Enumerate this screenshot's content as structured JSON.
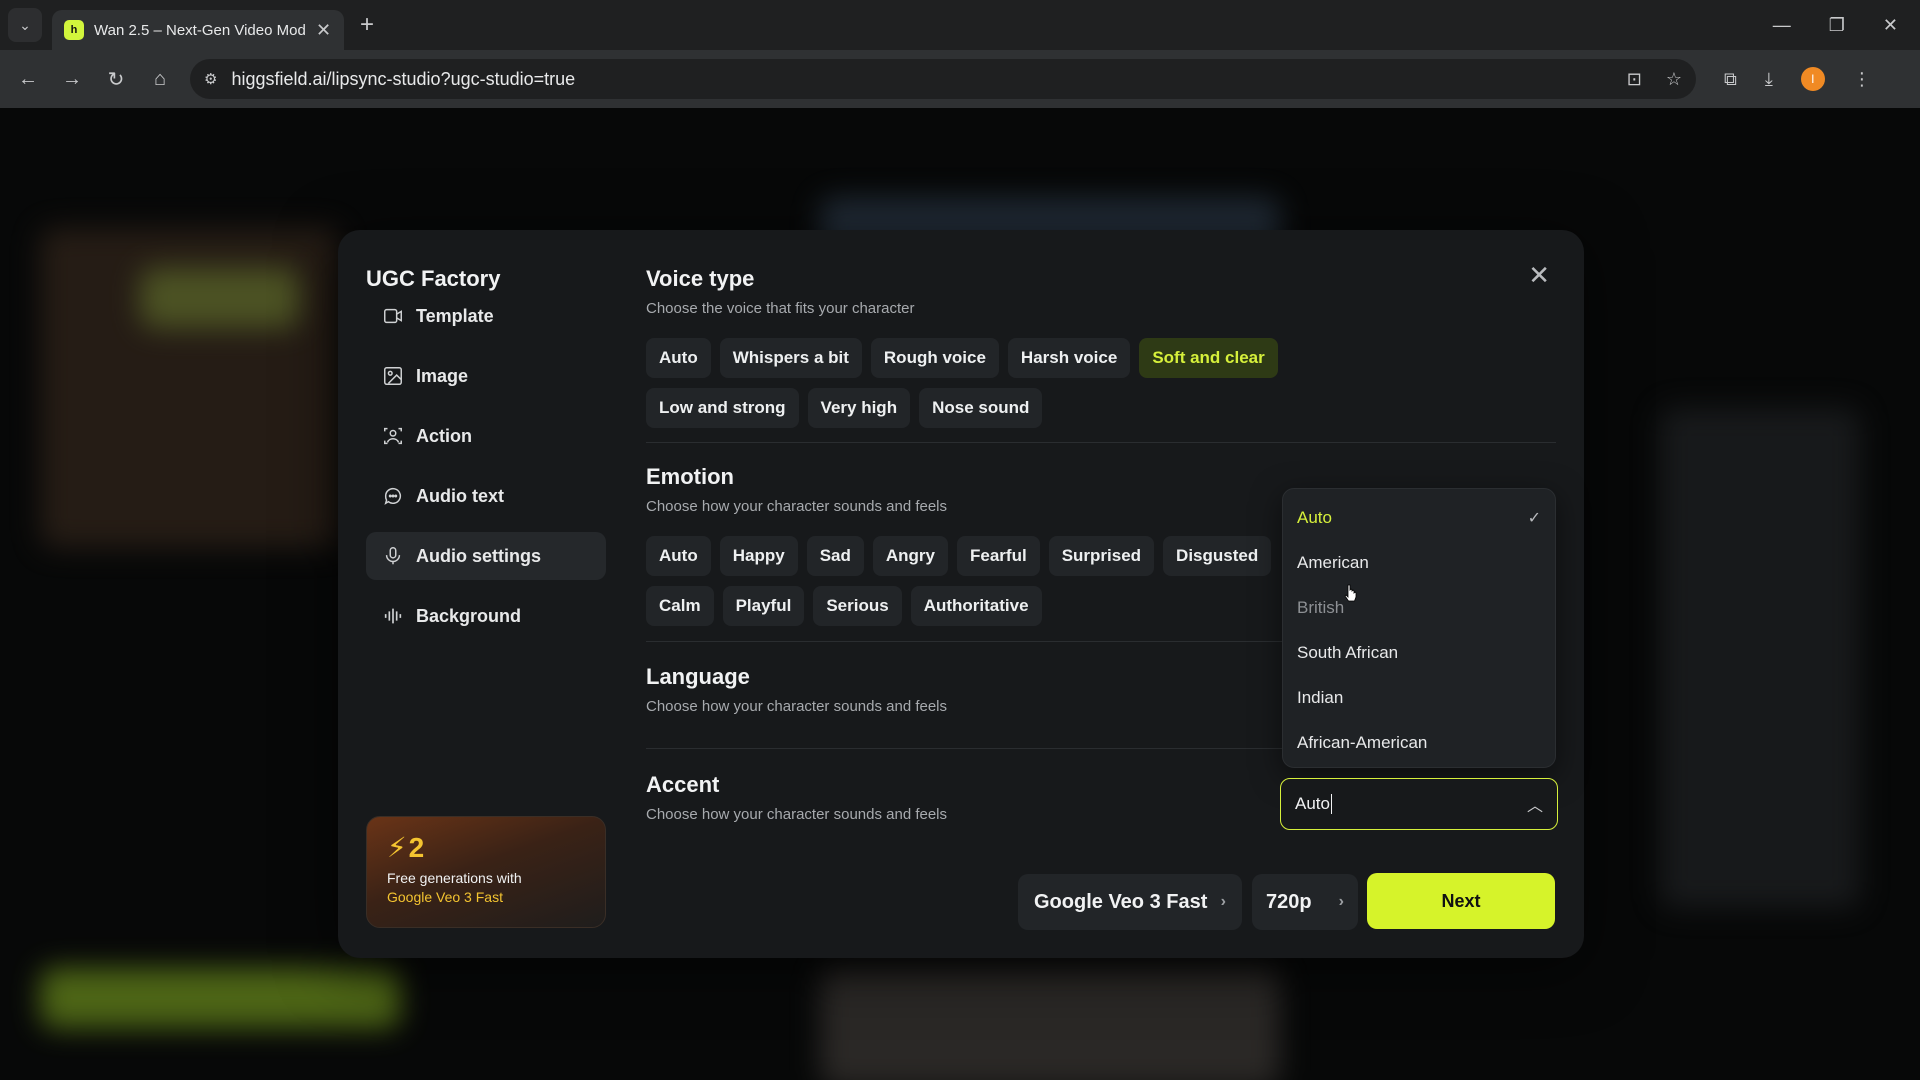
{
  "browser": {
    "tab_title": "Wan 2.5 – Next-Gen Video Mod",
    "url": "higgsfield.ai/lipsync-studio?ugc-studio=true"
  },
  "modal": {
    "title": "UGC Factory",
    "sidebar": [
      {
        "label": "Template",
        "icon": "template-icon"
      },
      {
        "label": "Image",
        "icon": "image-icon"
      },
      {
        "label": "Action",
        "icon": "action-icon"
      },
      {
        "label": "Audio text",
        "icon": "audio-text-icon"
      },
      {
        "label": "Audio settings",
        "icon": "microphone-icon",
        "active": true
      },
      {
        "label": "Background",
        "icon": "waveform-icon"
      }
    ],
    "promo": {
      "count": "2",
      "text": "Free generations with",
      "model": "Google Veo 3 Fast"
    },
    "voice_type": {
      "title": "Voice type",
      "subtitle": "Choose the voice that fits your character",
      "row1": [
        "Auto",
        "Whispers a bit",
        "Rough voice",
        "Harsh voice",
        "Soft and clear"
      ],
      "row2": [
        "Low and strong",
        "Very high",
        "Nose sound"
      ],
      "selected": "Soft and clear"
    },
    "emotion": {
      "title": "Emotion",
      "subtitle": "Choose how your character sounds and feels",
      "row1": [
        "Auto",
        "Happy",
        "Sad",
        "Angry",
        "Fearful",
        "Surprised",
        "Disgusted"
      ],
      "row2": [
        "Calm",
        "Playful",
        "Serious",
        "Authoritative"
      ]
    },
    "language": {
      "title": "Language",
      "subtitle": "Choose how your character sounds and feels"
    },
    "accent": {
      "title": "Accent",
      "subtitle": "Choose how your character sounds and feels",
      "value": "Auto",
      "options": [
        "Auto",
        "American",
        "British",
        "South African",
        "Indian",
        "African-American"
      ],
      "selected": "Auto"
    },
    "footer": {
      "model": "Google Veo 3 Fast",
      "resolution": "720p",
      "next_label": "Next"
    }
  },
  "colors": {
    "accent": "#d6f32a",
    "modal_bg": "#17191b",
    "chip_bg": "#222528"
  }
}
